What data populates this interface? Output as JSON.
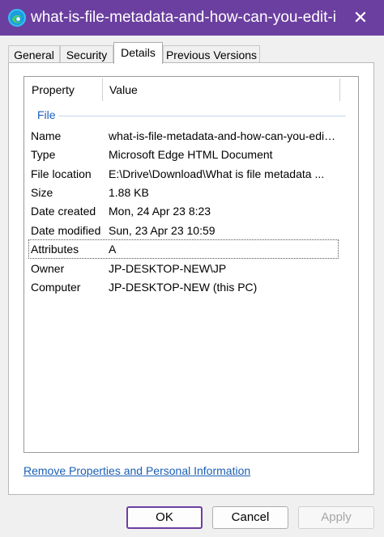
{
  "window": {
    "title": "what-is-file-metadata-and-how-can-you-edit-i...",
    "close_glyph": "✕"
  },
  "tabs": [
    {
      "label": "General",
      "active": false
    },
    {
      "label": "Security",
      "active": false
    },
    {
      "label": "Details",
      "active": true
    },
    {
      "label": "Previous Versions",
      "active": false
    }
  ],
  "details": {
    "columns": {
      "property": "Property",
      "value": "Value"
    },
    "group": "File",
    "rows": [
      {
        "property": "Name",
        "value": "what-is-file-metadata-and-how-can-you-edit..."
      },
      {
        "property": "Type",
        "value": "Microsoft Edge HTML Document"
      },
      {
        "property": "File location",
        "value": "E:\\Drive\\Download\\What is file metadata ..."
      },
      {
        "property": "Size",
        "value": "1.88 KB"
      },
      {
        "property": "Date created",
        "value": "Mon, 24 Apr 23 8:23"
      },
      {
        "property": "Date modified",
        "value": "Sun, 23 Apr 23 10:59"
      },
      {
        "property": "Attributes",
        "value": "A"
      },
      {
        "property": "Owner",
        "value": "JP-DESKTOP-NEW\\JP"
      },
      {
        "property": "Computer",
        "value": "JP-DESKTOP-NEW (this PC)"
      }
    ]
  },
  "link_label": "Remove Properties and Personal Information",
  "buttons": {
    "ok": "OK",
    "cancel": "Cancel",
    "apply": "Apply"
  },
  "colors": {
    "titlebar": "#6b3fa0",
    "link": "#1a5fb4",
    "group": "#1f5fbf"
  },
  "icons": {
    "app": "edge-document-icon",
    "close": "close-icon"
  }
}
